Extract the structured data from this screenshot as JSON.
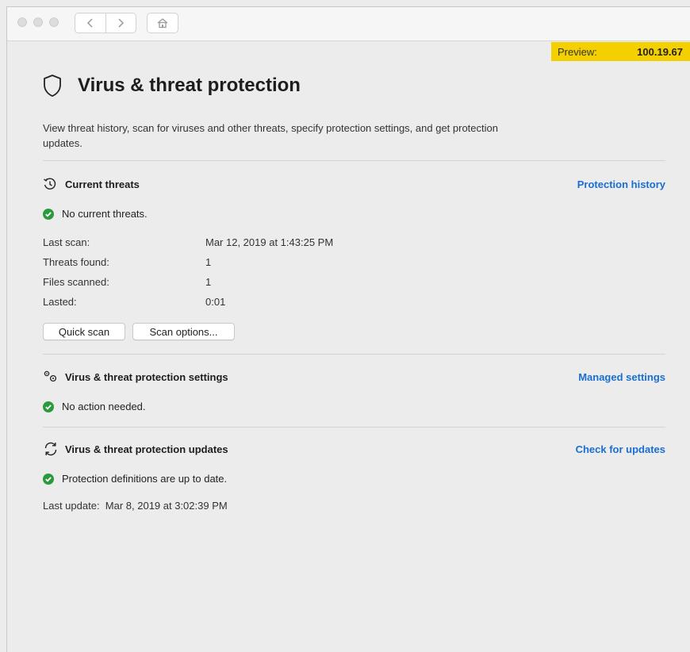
{
  "preview": {
    "label": "Preview:",
    "version": "100.19.67"
  },
  "page": {
    "title": "Virus & threat protection",
    "description": "View threat history, scan for viruses and other threats, specify protection settings, and get protection updates."
  },
  "current_threats": {
    "title": "Current threats",
    "link": "Protection history",
    "status": "No current threats.",
    "details": [
      {
        "label": "Last scan:",
        "value": "Mar 12, 2019 at 1:43:25 PM"
      },
      {
        "label": "Threats found:",
        "value": "1"
      },
      {
        "label": "Files scanned:",
        "value": "1"
      },
      {
        "label": "Lasted:",
        "value": "0:01"
      }
    ],
    "quick_scan_label": "Quick scan",
    "scan_options_label": "Scan options..."
  },
  "settings": {
    "title": "Virus & threat protection settings",
    "link": "Managed settings",
    "status": "No action needed."
  },
  "updates": {
    "title": "Virus & threat protection updates",
    "link": "Check for updates",
    "status": "Protection definitions are up to date.",
    "last_update": "Last update:  Mar 8, 2019 at 3:02:39 PM"
  },
  "colors": {
    "accent": "#1a6ed1",
    "ok": "#2a9a3c",
    "preview_bg": "#f5d000"
  },
  "icons": [
    "back-icon",
    "forward-icon",
    "home-icon",
    "shield-icon",
    "history-icon",
    "gears-icon",
    "refresh-icon",
    "check-circle-icon"
  ]
}
